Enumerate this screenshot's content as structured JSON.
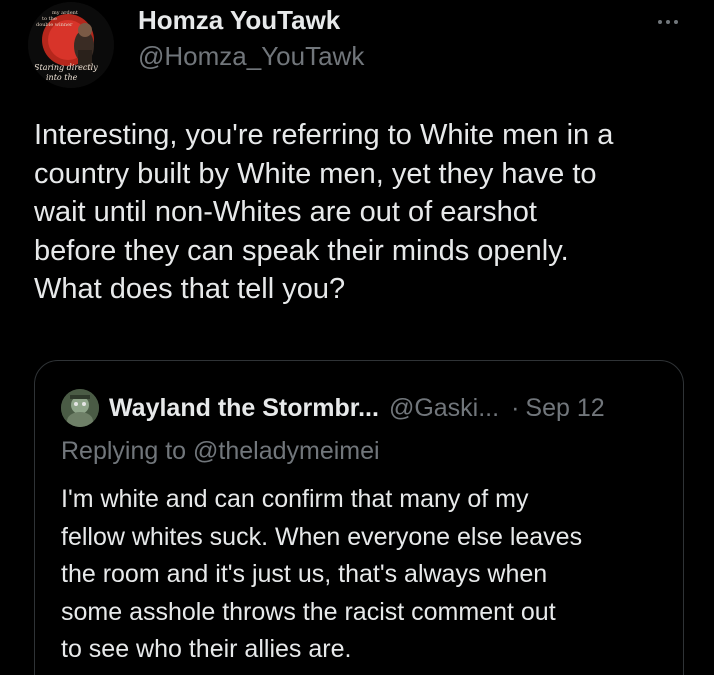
{
  "tweet": {
    "display_name": "Homza YouTawk",
    "handle": "@Homza_YouTawk",
    "more_icon": "more-horizontal-icon",
    "avatar_texts": [
      "my ardent",
      "to the",
      "double winner",
      "Staring directly",
      "into the"
    ],
    "text": "Interesting, you're referring to White men in a\ncountry built by White men, yet they have to\nwait until non-Whites are out of earshot\nbefore they can speak their minds openly.\nWhat does that tell you?"
  },
  "quote": {
    "display_name": "Wayland the Stormbr...",
    "handle": "@Gaski...",
    "separator": "·",
    "date": "Sep 12",
    "replying_prefix": "Replying to",
    "replying_to": "@theladymeimei",
    "text": "I'm white and can confirm that many of my\nfellow whites suck.  When everyone else leaves\nthe room and it's just us, that's always when\nsome asshole throws the racist comment out\nto see who their allies are."
  },
  "colors": {
    "background": "#000000",
    "primary_text": "#e7e9ea",
    "secondary_text": "#71767b",
    "border": "#2f3336"
  }
}
